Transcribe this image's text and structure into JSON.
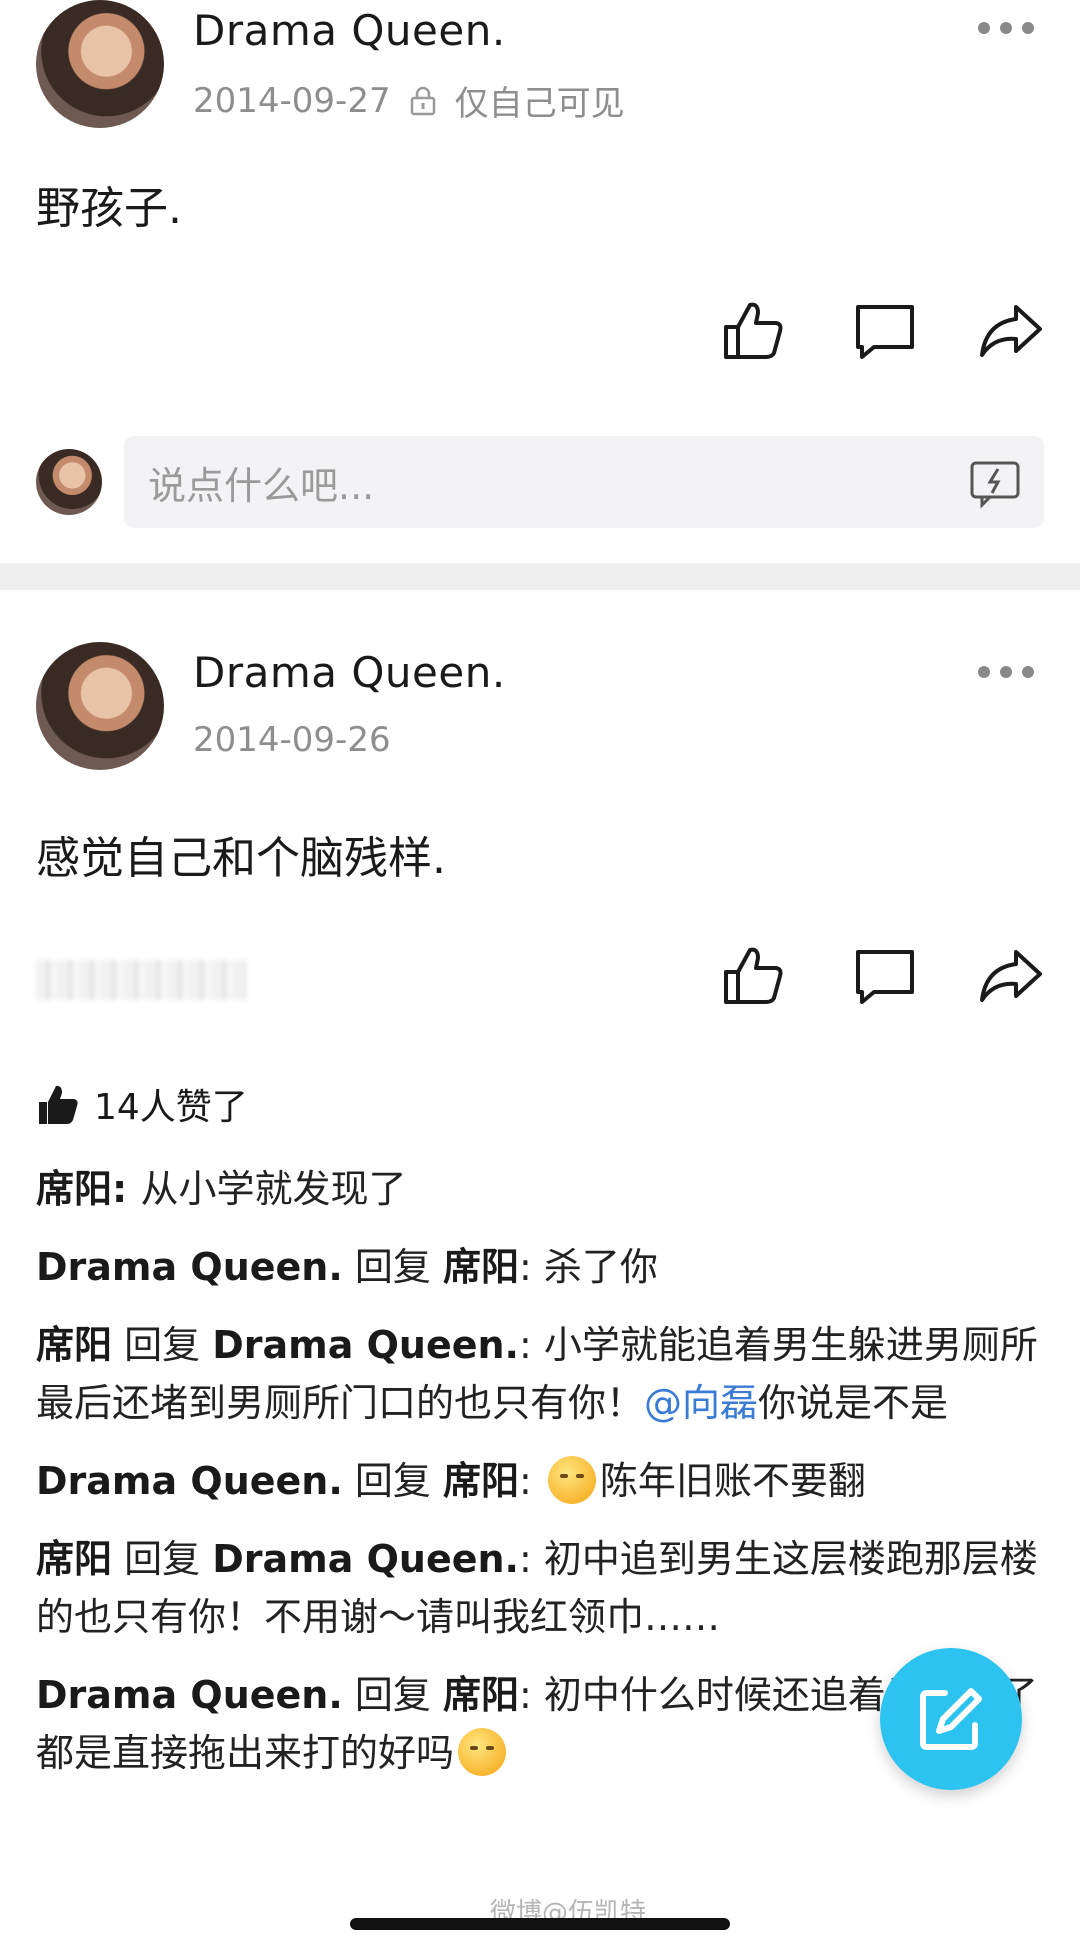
{
  "posts": [
    {
      "author": "Drama Queen.",
      "date": "2014-09-27",
      "privacy": "仅自己可见",
      "content": "野孩子.",
      "comment_placeholder": "说点什么吧..."
    },
    {
      "author": "Drama Queen.",
      "date": "2014-09-26",
      "content": "感觉自己和个脑残样.",
      "likes_text": "14人赞了",
      "comments": [
        {
          "author": "席阳",
          "sep": ": ",
          "text": "从小学就发现了"
        },
        {
          "author": "Drama Queen.",
          "reply_word": " 回复 ",
          "target": "席阳",
          "sep": ": ",
          "text": "杀了你"
        },
        {
          "author": "席阳",
          "reply_word": " 回复 ",
          "target": "Drama Queen.",
          "sep": ": ",
          "text": "小学就能追着男生躲进男厕所最后还堵到男厕所门口的也只有你！",
          "mention": "@向磊",
          "text_after": "你说是不是"
        },
        {
          "author": "Drama Queen.",
          "reply_word": " 回复 ",
          "target": "席阳",
          "sep": ": ",
          "text": "陈年旧账不要翻"
        },
        {
          "author": "席阳",
          "reply_word": " 回复 ",
          "target": "Drama Queen.",
          "sep": ": ",
          "text": "初中追到男生这层楼跑那层楼的也只有你！不用谢～请叫我红领巾……"
        },
        {
          "author": "Drama Queen.",
          "reply_word": " 回复 ",
          "target": "席阳",
          "sep": ": ",
          "text": "初中什么时候还追着男的打了 都是直接拖出来打的好吗"
        }
      ]
    }
  ],
  "watermark": "微博@伍凯特",
  "icons": {
    "lock": "lock-icon",
    "more": "more-icon",
    "like": "thumbs-up-icon",
    "comment": "comment-bubble-icon",
    "share": "share-arrow-icon",
    "emoji": "emoji-face-icon",
    "compose": "compose-edit-icon"
  },
  "colors": {
    "accent": "#2cc3f0",
    "mention": "#3a7bd5",
    "meta": "#8e8e8e"
  }
}
